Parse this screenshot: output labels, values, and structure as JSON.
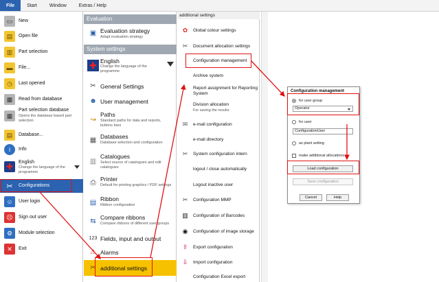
{
  "menubar": {
    "tabs": [
      "File",
      "Start",
      "Window",
      "Extras / Help"
    ],
    "active": "File"
  },
  "left_menu": {
    "items": [
      {
        "label": "New",
        "sub": "",
        "icon": "new-icon"
      },
      {
        "label": "Open file",
        "sub": "",
        "icon": "open-file-icon"
      },
      {
        "label": "Part selection",
        "sub": "",
        "icon": "part-selection-icon"
      },
      {
        "label": "File...",
        "sub": "",
        "icon": "folder-icon"
      },
      {
        "label": "Last opened",
        "sub": "",
        "icon": "folder-clock-icon"
      },
      {
        "label": "Read from database",
        "sub": "",
        "icon": "database-read-icon"
      },
      {
        "label": "Part selection database",
        "sub": "Opens the database based part selection",
        "icon": "part-database-icon"
      },
      {
        "label": "Database...",
        "sub": "",
        "icon": "database-folder-icon"
      },
      {
        "label": "Info",
        "sub": "",
        "icon": "info-icon"
      },
      {
        "label": "English",
        "sub": "Change the language of the programme",
        "icon": "uk-flag-icon"
      },
      {
        "label": "Configurations",
        "sub": "",
        "icon": "configurations-icon"
      },
      {
        "label": "User login",
        "sub": "",
        "icon": "user-login-icon"
      },
      {
        "label": "Sign out user",
        "sub": "",
        "icon": "sign-out-icon"
      },
      {
        "label": "Module selection",
        "sub": "",
        "icon": "module-selection-icon"
      },
      {
        "label": "Exit",
        "sub": "",
        "icon": "exit-icon"
      }
    ],
    "selected": "Configurations"
  },
  "middle_menu": {
    "section1": "Evaluation",
    "section2": "System settings",
    "items": [
      {
        "label": "Evaluation strategy",
        "sub": "Adapt evaluation strategy",
        "icon": "evaluation-strategy-icon"
      },
      {
        "label": "English",
        "sub": "Change the language of the programme",
        "icon": "uk-flag-icon"
      },
      {
        "label": "General Settings",
        "sub": "",
        "icon": "tools-icon"
      },
      {
        "label": "User management",
        "sub": "",
        "icon": "user-management-icon"
      },
      {
        "label": "Paths",
        "sub": "Standard paths for data and reports, buttons bars",
        "icon": "paths-icon"
      },
      {
        "label": "Databases",
        "sub": "Database selection and configuration",
        "icon": "databases-icon"
      },
      {
        "label": "Catalogues",
        "sub": "Select source of catalogues and edit catalogues",
        "icon": "catalogues-icon"
      },
      {
        "label": "Printer",
        "sub": "Default for printing graphics / PDF settings",
        "icon": "printer-icon"
      },
      {
        "label": "Ribbon",
        "sub": "Ribbon configuration",
        "icon": "ribbon-icon"
      },
      {
        "label": "Compare ribbons",
        "sub": "Compare ribbons of different user groups",
        "icon": "compare-ribbons-icon"
      },
      {
        "label": "Fields, input and output",
        "sub": "",
        "icon": "fields-icon"
      },
      {
        "label": "Alarms",
        "sub": "",
        "icon": "alarms-icon"
      },
      {
        "label": "additional settings",
        "sub": "",
        "icon": "additional-settings-icon"
      }
    ],
    "selected": "additional settings"
  },
  "right_menu": {
    "header": "additional settings",
    "items": [
      {
        "label": "Global colour settings",
        "sub": "",
        "icon": "colour-settings-icon"
      },
      {
        "label": "Document allocation settings",
        "sub": "",
        "icon": "document-allocation-icon"
      },
      {
        "label": "Configuration management",
        "sub": "",
        "icon": ""
      },
      {
        "label": "Archive system",
        "sub": "",
        "icon": ""
      },
      {
        "label": "Report assignment for Reporting System",
        "sub": "",
        "icon": ""
      },
      {
        "label": "Division allocation",
        "sub": "For saving the results",
        "icon": ""
      },
      {
        "label": "e-mail configuration",
        "sub": "",
        "icon": "email-icon"
      },
      {
        "label": "e-mail directory",
        "sub": "",
        "icon": ""
      },
      {
        "label": "System configuration intern",
        "sub": "",
        "icon": "system-config-icon"
      },
      {
        "label": "logout / close automatically",
        "sub": "",
        "icon": ""
      },
      {
        "label": "Logout inactive user",
        "sub": "",
        "icon": ""
      },
      {
        "label": "Configuration MMP",
        "sub": "",
        "icon": "tools-icon"
      },
      {
        "label": "Configuration of Barcodes",
        "sub": "",
        "icon": "barcode-icon"
      },
      {
        "label": "Configuration of image storage",
        "sub": "",
        "icon": "camera-icon"
      },
      {
        "label": "Export configuration",
        "sub": "",
        "icon": "export-icon"
      },
      {
        "label": "Import configuration",
        "sub": "",
        "icon": "import-icon"
      },
      {
        "label": "Configuration Excel export",
        "sub": "",
        "icon": ""
      }
    ]
  },
  "dialog": {
    "title": "Configuration management",
    "opt_group": "for user group",
    "group_value": "Operator",
    "opt_user": "for user",
    "user_value": "ConfigurationUser",
    "opt_plant": "as plant setting",
    "check_additional": "make additional allocations",
    "load_button": "Load configuration",
    "save_button": "Save configuration",
    "cancel_button": "Cancel",
    "help_button": "Help",
    "selected_option": "for user group"
  },
  "annotation_color": "#e01010",
  "accent_color": "#2b63b0",
  "highlight_color": "#f6c200"
}
